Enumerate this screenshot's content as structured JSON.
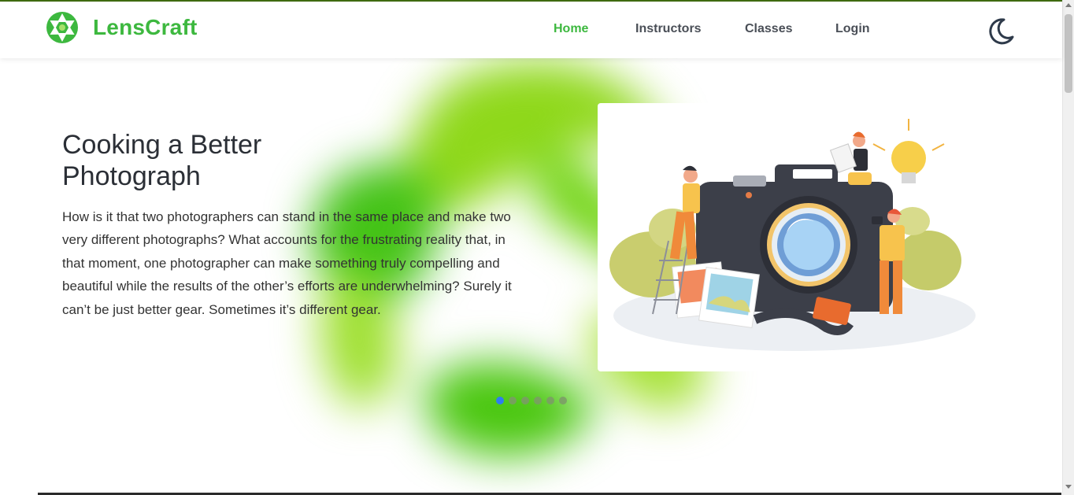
{
  "brand": {
    "name": "LensCraft",
    "color": "#3db83f",
    "logo_icon": "aperture-icon"
  },
  "nav": {
    "items": [
      {
        "label": "Home",
        "active": true
      },
      {
        "label": "Instructors",
        "active": false
      },
      {
        "label": "Classes",
        "active": false
      },
      {
        "label": "Login",
        "active": false
      }
    ],
    "theme_toggle_icon": "moon-icon"
  },
  "hero": {
    "title": "Cooking a Better Photograph",
    "body": "How is it that two photographers can stand in the same place and make two very different photographs? What accounts for the frustrating reality that, in that moment, one photographer can make something truly compelling and beautiful while the results of the other’s efforts are underwhelming? Surely it can’t be just better gear. Sometimes it’s different gear.",
    "illustration": "camera-photographers-illustration"
  },
  "carousel": {
    "slide_count": 6,
    "active_index": 0,
    "active_color": "#2f7cf0"
  },
  "colors": {
    "accent": "#3db83f",
    "top_border": "#3f6b10",
    "text": "#2b2f36"
  }
}
